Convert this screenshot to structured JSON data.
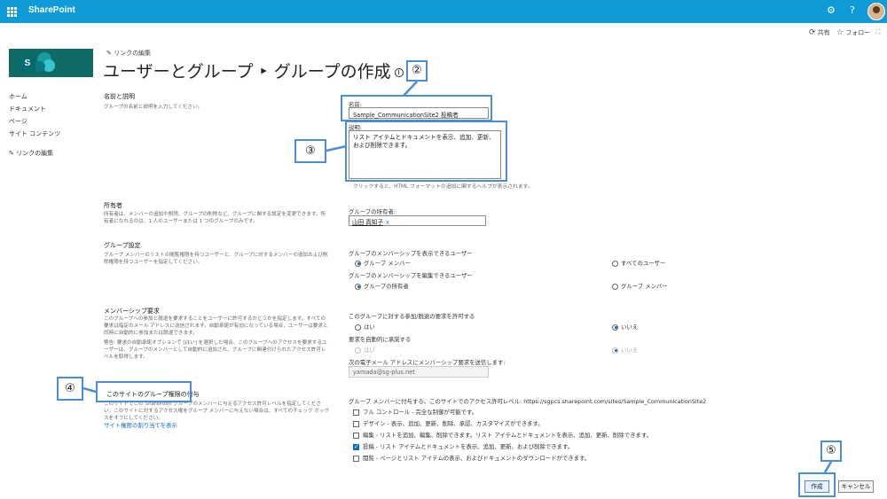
{
  "suite": {
    "brand": "SharePoint",
    "help": "?"
  },
  "command_bar": {
    "share": "共有",
    "follow": "フォロー"
  },
  "site_logo_letter": "S",
  "nav": {
    "items": [
      "ホーム",
      "ドキュメント",
      "ページ",
      "サイト コンテンツ"
    ],
    "edit_links": "リンクの編集"
  },
  "breadcrumb": "リンクの編集",
  "page_title": "ユーザーとグループ ‣ グループの作成",
  "title_info": "i",
  "sections": {
    "name_desc": {
      "heading": "名前と説明",
      "desc": "グループの名前と説明を入力してください。"
    },
    "owner": {
      "heading": "所有者",
      "desc": "所有者は、メンバーの追加や削除、グループの削除など、グループに関する設定を変更できます。所有者になれるのは、1 人のユーザーまたは 1 つのグループのみです。"
    },
    "group_settings": {
      "heading": "グループ設定",
      "desc": "グループ メンバーのリストの閲覧権限を持つユーザーと、グループに対するメンバーの追加および削除権限を持つユーザーを指定してください。"
    },
    "membership": {
      "heading": "メンバーシップ要求",
      "desc": "このグループへの参加と脱退を要求することをユーザーに許可するかどうかを指定します。すべての要求は指定のメール アドレスに送信されます。自動承諾が有効になっている場合、ユーザーは要求と同時に自動的に参加または脱退できます。",
      "warning": "警告: 要求の自動承諾オプションで [はい] を選択した場合、このグループへのアクセスを要求するユーザーは、グループのメンバーとして自動的に追加され、グループに関連付けられたアクセス許可レベルを取得します。"
    },
    "permissions": {
      "heading": "このサイトのグループ権限の付与",
      "desc": "このサイトでこの SharePoint グループのメンバーに与えるアクセス許可レベルを指定してください。このサイトに対するアクセス権をグループ メンバーに与えない場合は、すべてのチェック ボックスをオフにしてください。",
      "link": "サイト権限の割り当てを表示"
    }
  },
  "form": {
    "name_label": "名前:",
    "name_value": "Sample_CommunicationSite2 投稿者",
    "desc_label": "説明:",
    "desc_value": "リスト アイテムとドキュメントを表示、追加、更新、および削除できます。",
    "desc_hint": "クリックすると、HTML フォーマットの追加に関するヘルプが表示されます。",
    "owner_label": "グループの所有者:",
    "owner_name": "山田 真知子",
    "owner_remove": "×",
    "view_label": "グループのメンバーシップを表示できるユーザー",
    "view_opt1": "グループ メンバー",
    "view_opt2": "すべてのユーザー",
    "edit_label": "グループのメンバーシップを編集できるユーザー",
    "edit_opt1": "グループの所有者",
    "edit_opt2": "グループ メンバー",
    "allow_label": "このグループに対する参加/脱退の要求を許可する",
    "yes": "はい",
    "no": "いいえ",
    "auto_label": "要求を自動的に承諾する",
    "email_label": "次の電子メール アドレスにメンバーシップ要求を送信します:",
    "email_value": "yamada@sg-plus.net",
    "perm_label": "グループ メンバーに付与する、このサイトでのアクセス許可レベル: https://sgpcs.sharepoint.com/sites/Sample_CommunicationSite2",
    "perms": [
      "フル コントロール - 完全な制御が可能です。",
      "デザイン - 表示、追加、更新、削除、承認、カスタマイズができます。",
      "編集 - リストを追加、編集、削除できます。リスト アイテムとドキュメントを表示、追加、更新、削除できます。",
      "投稿 - リスト アイテムとドキュメントを表示、追加、更新、および削除できます。",
      "閲覧 - ページとリスト アイテムの表示、およびドキュメントのダウンロードができます。"
    ],
    "perm_checked_index": 3
  },
  "buttons": {
    "create": "作成",
    "cancel": "キャンセル"
  },
  "callouts": {
    "c2": "②",
    "c3": "③",
    "c4": "④",
    "c5": "⑤"
  },
  "colors": {
    "suite_bar": "#0f9bd7",
    "callout": "#4a8fd6",
    "logo": "#106b66"
  }
}
